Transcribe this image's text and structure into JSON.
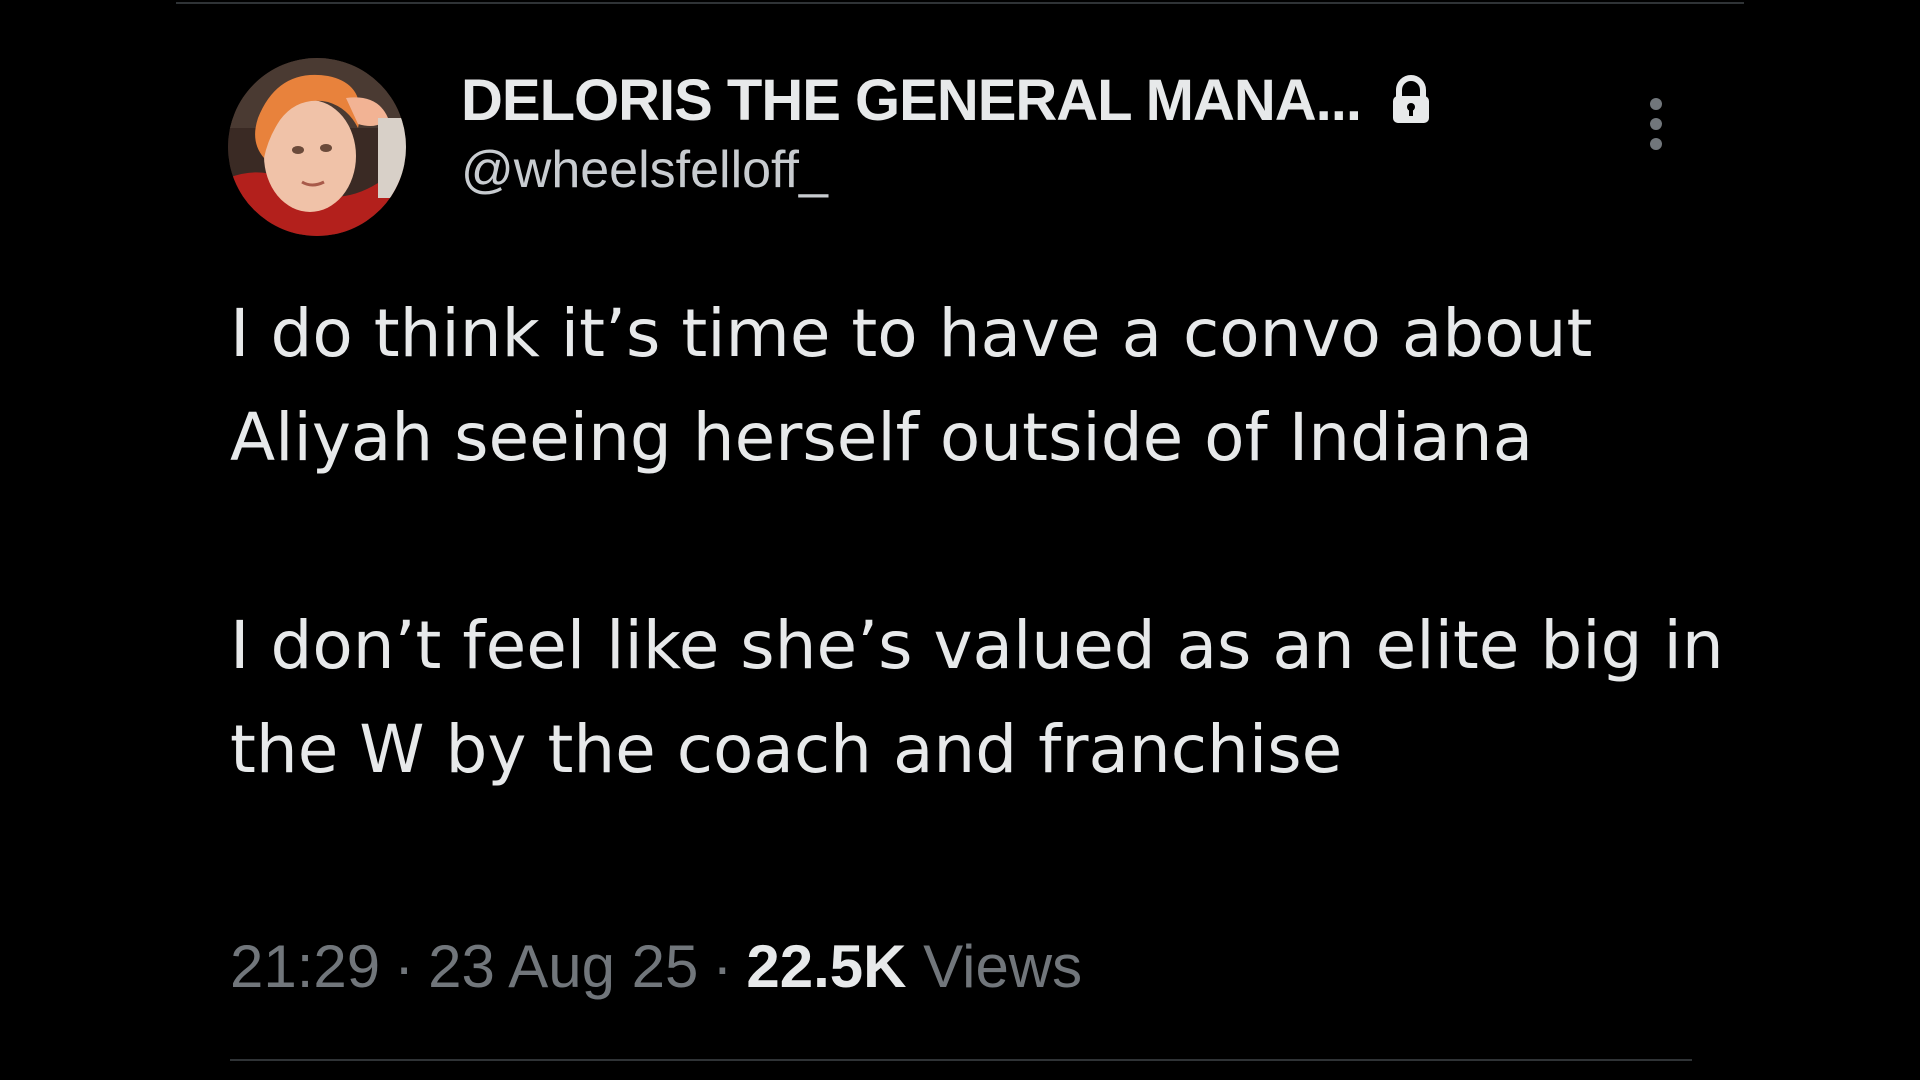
{
  "tweet": {
    "author": {
      "display_name": "DELORIS THE GENERAL MANA...",
      "handle": "@wheelsfelloff_",
      "protected_icon": "lock-icon",
      "avatar_icon": "profile-photo"
    },
    "text": [
      "I do think it’s time to have a convo about Aliyah seeing herself outside of Indiana",
      "I don’t feel like she’s valued as an elite big in the W by the coach and franchise"
    ],
    "time": "21:29",
    "separator": "·",
    "date": "23 Aug 25",
    "views_count": "22.5K",
    "views_label": "Views",
    "more_icon": "more-vertical-icon"
  },
  "colors": {
    "background": "#000000",
    "primary_text": "#e7e9ea",
    "secondary_text": "#71767b",
    "divider": "#2f3336"
  }
}
